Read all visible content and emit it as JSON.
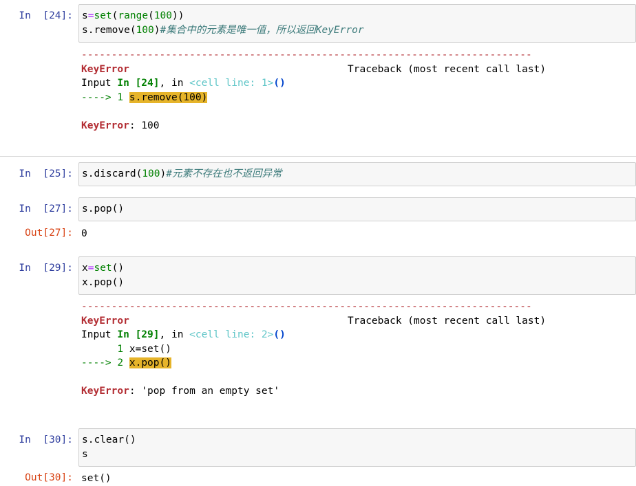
{
  "cells": [
    {
      "prompt": "In  [24]:",
      "code": {
        "l1_s": "s",
        "l1_eq": "=",
        "l1_set": "set",
        "l1_p1": "(",
        "l1_range": "range",
        "l1_p2": "(",
        "l1_num": "100",
        "l1_p3": "))",
        "l2_a": "s.remove(",
        "l2_num": "100",
        "l2_b": ")",
        "l2_comment": "#集合中的元素是唯一值，所以返回KeyError"
      },
      "error": {
        "separator": "---------------------------------------------------------------------------",
        "name": "KeyError",
        "traceback_label": "Traceback (most recent call last)",
        "input_label": "Input ",
        "input_ref": "In [24]",
        "input_mid": ", in ",
        "cell_ref": "<cell line: 1>",
        "cell_paren": "()",
        "arrow": "----> ",
        "arrow_lineno": "1",
        "hl_code": "s.remove(100)",
        "final_name": "KeyError",
        "final_msg": ": 100"
      }
    },
    {
      "prompt": "In  [25]:",
      "code": {
        "a": "s.discard(",
        "num": "100",
        "b": ")",
        "comment": "#元素不存在也不返回异常"
      }
    },
    {
      "prompt": "In  [27]:",
      "code": {
        "a": "s.pop()"
      },
      "out_prompt": "Out[27]:",
      "out_value": "0"
    },
    {
      "prompt": "In  [29]:",
      "code": {
        "l1_x": "x",
        "l1_eq": "=",
        "l1_set": "set",
        "l1_p": "()",
        "l2": "x.pop()"
      },
      "error": {
        "separator": "---------------------------------------------------------------------------",
        "name": "KeyError",
        "traceback_label": "Traceback (most recent call last)",
        "input_label": "Input ",
        "input_ref": "In [29]",
        "input_mid": ", in ",
        "cell_ref": "<cell line: 2>",
        "cell_paren": "()",
        "ctx_indent": "      ",
        "ctx_lineno": "1",
        "ctx_code": " x=set()",
        "arrow": "----> ",
        "arrow_lineno": "2",
        "hl_code": "x.pop()",
        "final_name": "KeyError",
        "final_msg": ": 'pop from an empty set'"
      }
    },
    {
      "prompt": "In  [30]:",
      "code": {
        "l1": "s.clear()",
        "l2": "s"
      },
      "out_prompt": "Out[30]:",
      "out_value": "set()"
    }
  ]
}
